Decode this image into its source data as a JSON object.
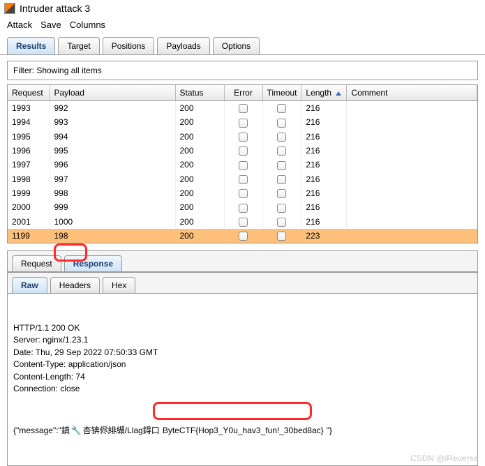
{
  "window": {
    "title": "Intruder attack 3"
  },
  "menu": {
    "items": [
      "Attack",
      "Save",
      "Columns"
    ]
  },
  "mainTabs": [
    "Results",
    "Target",
    "Positions",
    "Payloads",
    "Options"
  ],
  "activeMainTab": 0,
  "filter": {
    "text": "Filter: Showing all items"
  },
  "columns": {
    "request": "Request",
    "payload": "Payload",
    "status": "Status",
    "error": "Error",
    "timeout": "Timeout",
    "length": "Length",
    "comment": "Comment"
  },
  "sortColumn": "length",
  "rows": [
    {
      "request": "1993",
      "payload": "992",
      "status": "200",
      "length": "216",
      "selected": false
    },
    {
      "request": "1994",
      "payload": "993",
      "status": "200",
      "length": "216",
      "selected": false
    },
    {
      "request": "1995",
      "payload": "994",
      "status": "200",
      "length": "216",
      "selected": false
    },
    {
      "request": "1996",
      "payload": "995",
      "status": "200",
      "length": "216",
      "selected": false
    },
    {
      "request": "1997",
      "payload": "996",
      "status": "200",
      "length": "216",
      "selected": false
    },
    {
      "request": "1998",
      "payload": "997",
      "status": "200",
      "length": "216",
      "selected": false
    },
    {
      "request": "1999",
      "payload": "998",
      "status": "200",
      "length": "216",
      "selected": false
    },
    {
      "request": "2000",
      "payload": "999",
      "status": "200",
      "length": "216",
      "selected": false
    },
    {
      "request": "2001",
      "payload": "1000",
      "status": "200",
      "length": "216",
      "selected": false
    },
    {
      "request": "1199",
      "payload": "198",
      "status": "200",
      "length": "223",
      "selected": true
    }
  ],
  "subTabs": [
    "Request",
    "Response"
  ],
  "activeSubTab": 1,
  "subSubTabs": [
    "Raw",
    "Headers",
    "Hex"
  ],
  "activeSubSubTab": 0,
  "response": {
    "lines": [
      "HTTP/1.1 200 OK",
      "Server: nginx/1.23.1",
      "Date: Thu, 29 Sep 2022 07:50:33 GMT",
      "Content-Type: application/json",
      "Content-Length: 74",
      "Connection: close"
    ],
    "msgPrefix": "{\"message\":\"鎮",
    "msgMid": "杏锛侭緋纈/Llag鍀口",
    "msgFlag": "ByteCTF{Hop3_Y0u_hav3_fun!_30bed8ac}",
    "msgSuffix": "\"}"
  },
  "watermark": "CSDN @iReverse"
}
